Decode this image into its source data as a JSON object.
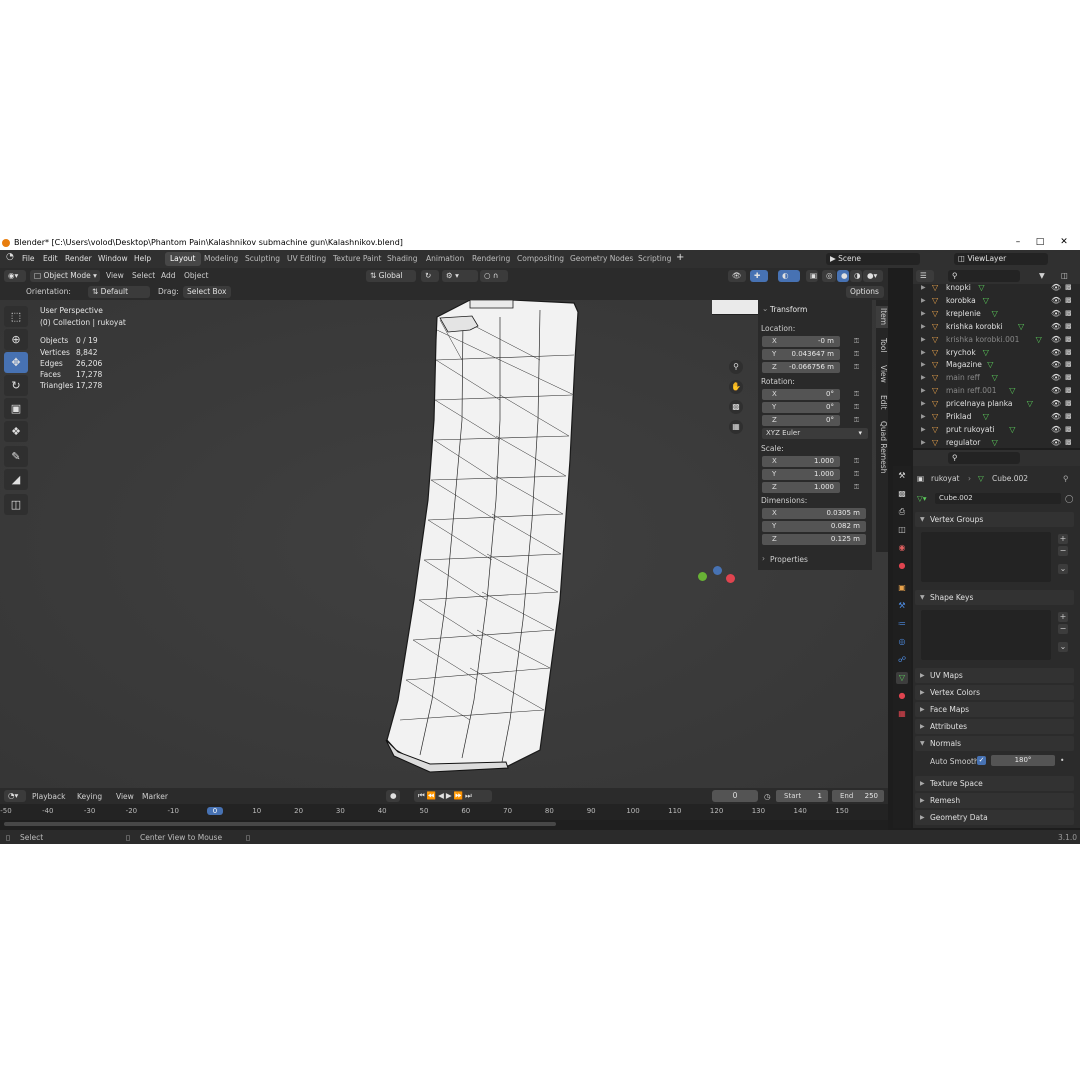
{
  "window": {
    "title": "Blender* [C:\\Users\\volod\\Desktop\\Phantom Pain\\Kalashnikov submachine gun\\Kalashnikov.blend]",
    "buttons": [
      "–",
      "□",
      "✕"
    ]
  },
  "menu": [
    "File",
    "Edit",
    "Render",
    "Window",
    "Help"
  ],
  "workspaces": [
    "Layout",
    "Modeling",
    "Sculpting",
    "UV Editing",
    "Texture Paint",
    "Shading",
    "Animation",
    "Rendering",
    "Compositing",
    "Geometry Nodes",
    "Scripting"
  ],
  "active_workspace": "Layout",
  "scene": {
    "label": "Scene",
    "view_layer": "ViewLayer"
  },
  "header": {
    "mode": "Object Mode",
    "menus": [
      "View",
      "Select",
      "Add",
      "Object"
    ],
    "transform_space": "Global",
    "options": "Options"
  },
  "header2": {
    "orientation_label": "Orientation:",
    "orientation_value": "Default",
    "drag_label": "Drag:",
    "drag_value": "Select Box"
  },
  "viewport": {
    "perspective": "User Perspective",
    "collection": "(0) Collection | rukoyat",
    "stats": [
      {
        "label": "Objects",
        "value": "0 / 19"
      },
      {
        "label": "Vertices",
        "value": "8,842"
      },
      {
        "label": "Edges",
        "value": "26,206"
      },
      {
        "label": "Faces",
        "value": "17,278"
      },
      {
        "label": "Triangles",
        "value": "17,278"
      }
    ]
  },
  "transform": {
    "title": "Transform",
    "location_label": "Location:",
    "location": [
      {
        "axis": "X",
        "value": "-0 m"
      },
      {
        "axis": "Y",
        "value": "0.043647 m"
      },
      {
        "axis": "Z",
        "value": "-0.066756 m"
      }
    ],
    "rotation_label": "Rotation:",
    "rotation": [
      {
        "axis": "X",
        "value": "0°"
      },
      {
        "axis": "Y",
        "value": "0°"
      },
      {
        "axis": "Z",
        "value": "0°"
      }
    ],
    "rotation_mode": "XYZ Euler",
    "scale_label": "Scale:",
    "scale": [
      {
        "axis": "X",
        "value": "1.000"
      },
      {
        "axis": "Y",
        "value": "1.000"
      },
      {
        "axis": "Z",
        "value": "1.000"
      }
    ],
    "dimensions_label": "Dimensions:",
    "dimensions": [
      {
        "axis": "X",
        "value": "0.0305 m"
      },
      {
        "axis": "Y",
        "value": "0.082 m"
      },
      {
        "axis": "Z",
        "value": "0.125 m"
      }
    ],
    "properties": "Properties"
  },
  "npanel_tabs": [
    "Item",
    "Tool",
    "View",
    "Edit",
    "Quad Remesh"
  ],
  "outliner": {
    "items": [
      {
        "name": "knopki",
        "dim": false
      },
      {
        "name": "korobka",
        "dim": false
      },
      {
        "name": "kreplenie",
        "dim": false
      },
      {
        "name": "krishka korobki",
        "dim": false
      },
      {
        "name": "krishka korobki.001",
        "dim": true
      },
      {
        "name": "krychok",
        "dim": false
      },
      {
        "name": "Magazine",
        "dim": false
      },
      {
        "name": "main reff",
        "dim": true
      },
      {
        "name": "main reff.001",
        "dim": true
      },
      {
        "name": "pricelnaya planka",
        "dim": false
      },
      {
        "name": "Priklad",
        "dim": false
      },
      {
        "name": "prut rukoyati",
        "dim": false
      },
      {
        "name": "regulator",
        "dim": false
      }
    ]
  },
  "properties": {
    "object": "rukoyat",
    "mesh": "Cube.002",
    "mesh_field": "Cube.002",
    "sections": {
      "vertex_groups": "Vertex Groups",
      "shape_keys": "Shape Keys",
      "uv_maps": "UV Maps",
      "vertex_colors": "Vertex Colors",
      "face_maps": "Face Maps",
      "attributes": "Attributes",
      "normals": "Normals",
      "texture_space": "Texture Space",
      "remesh": "Remesh",
      "geometry_data": "Geometry Data"
    },
    "auto_smooth_label": "Auto Smooth",
    "auto_smooth_angle": "180°"
  },
  "timeline": {
    "menus": [
      "Playback",
      "Keying",
      "View",
      "Marker"
    ],
    "current_frame": "0",
    "start_label": "Start",
    "start": "1",
    "end_label": "End",
    "end": "250",
    "ticks": [
      "-50",
      "-40",
      "-30",
      "-20",
      "-10",
      "0",
      "10",
      "20",
      "30",
      "40",
      "50",
      "60",
      "70",
      "80",
      "90",
      "100",
      "110",
      "120",
      "130",
      "140",
      "150"
    ]
  },
  "status": {
    "left": "Select",
    "middle": "Center View to Mouse",
    "version": "3.1.0"
  },
  "colors": {
    "accent": "#4772b3",
    "object_icon": "#e8a24b",
    "mesh_icon": "#5ccf5c"
  }
}
